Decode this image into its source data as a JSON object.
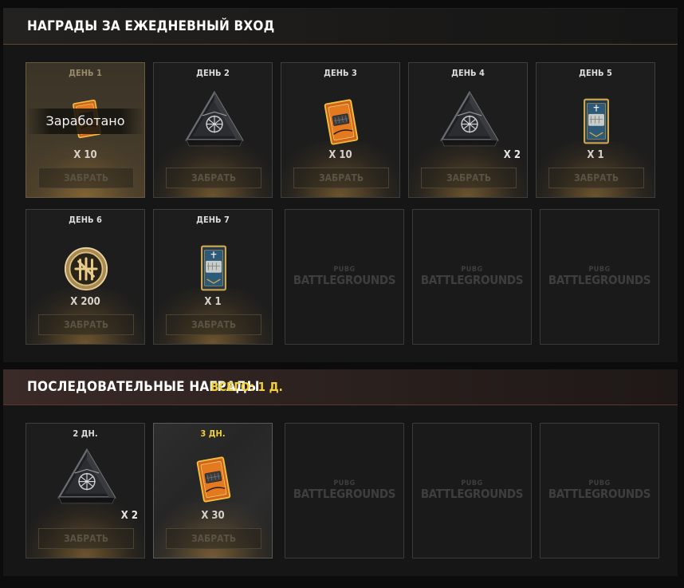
{
  "daily": {
    "title": "НАГРАДЫ ЗА ЕЖЕДНЕВНЫЙ ВХОД",
    "cards": [
      {
        "day": "ДЕНЬ 1",
        "item_icon": "orange-ticket-icon",
        "qty": "X 10",
        "status": "Заработано",
        "claim": "ЗАБРАТЬ"
      },
      {
        "day": "ДЕНЬ 2",
        "item_icon": "crate-icon",
        "qty": "",
        "claim": "ЗАБРАТЬ"
      },
      {
        "day": "ДЕНЬ 3",
        "item_icon": "orange-ticket-icon",
        "qty": "X 10",
        "claim": "ЗАБРАТЬ"
      },
      {
        "day": "ДЕНЬ 4",
        "item_icon": "crate-icon",
        "qty": "X 2",
        "claim": "ЗАБРАТЬ"
      },
      {
        "day": "ДЕНЬ 5",
        "item_icon": "blue-card-icon",
        "qty": "X 1",
        "claim": "ЗАБРАТЬ"
      },
      {
        "day": "ДЕНЬ 6",
        "item_icon": "coin-icon",
        "qty": "X 200",
        "claim": "ЗАБРАТЬ"
      },
      {
        "day": "ДЕНЬ 7",
        "item_icon": "blue-card-icon",
        "qty": "X 1",
        "claim": "ЗАБРАТЬ"
      }
    ],
    "placeholders": [
      {
        "brand_small": "PUBG",
        "brand_big": "BATTLEGROUNDS"
      },
      {
        "brand_small": "PUBG",
        "brand_big": "BATTLEGROUNDS"
      },
      {
        "brand_small": "PUBG",
        "brand_big": "BATTLEGROUNDS"
      }
    ]
  },
  "streak": {
    "title": "ПОСЛЕДОВАТЕЛЬНЫЕ НАГРАДЫ",
    "total": "ВСЕГО: 1 Д.",
    "cards": [
      {
        "day": "2 ДН.",
        "item_icon": "crate-icon",
        "qty": "X 2",
        "claim": "ЗАБРАТЬ"
      },
      {
        "day": "3 ДН.",
        "item_icon": "orange-ticket-icon",
        "qty": "X 30",
        "claim": "ЗАБРАТЬ"
      }
    ],
    "placeholders": [
      {
        "brand_small": "PUBG",
        "brand_big": "BATTLEGROUNDS"
      },
      {
        "brand_small": "PUBG",
        "brand_big": "BATTLEGROUNDS"
      },
      {
        "brand_small": "PUBG",
        "brand_big": "BATTLEGROUNDS"
      }
    ]
  },
  "colors": {
    "accent_yellow": "#f3d036",
    "panel_bg": "#161616",
    "card_border": "#3e3e3e",
    "glow": "#b0823c"
  }
}
